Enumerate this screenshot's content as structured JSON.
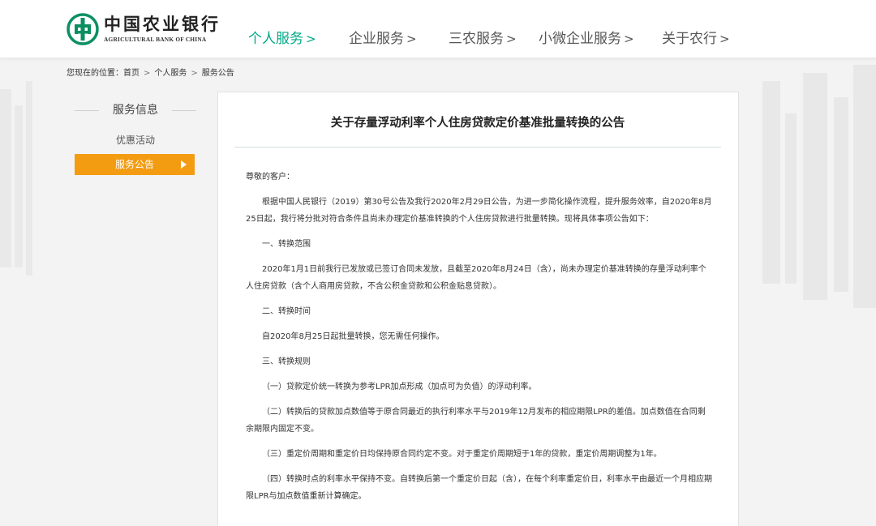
{
  "header": {
    "logo_cn": "中国农业银行",
    "logo_en": "AGRICULTURAL BANK OF CHINA",
    "nav": [
      {
        "label": "个人服务",
        "arrow": ">"
      },
      {
        "label": "企业服务",
        "arrow": ">"
      },
      {
        "label": "三农服务",
        "arrow": ">"
      },
      {
        "label": "小微企业服务",
        "arrow": ">"
      },
      {
        "label": "关于农行",
        "arrow": ">"
      }
    ]
  },
  "breadcrumb": {
    "prefix": "您现在的位置：",
    "items": [
      "首页",
      "个人服务",
      "服务公告"
    ],
    "sep": ">"
  },
  "sidebar": {
    "title": "服务信息",
    "items": [
      "优惠活动",
      "服务公告"
    ]
  },
  "article": {
    "title": "关于存量浮动利率个人住房贷款定价基准批量转换的公告",
    "paragraphs": [
      "尊敬的客户：",
      "根据中国人民银行（2019）第30号公告及我行2020年2月29日公告，为进一步简化操作流程，提升服务效率，自2020年8月25日起，我行将分批对符合条件且尚未办理定价基准转换的个人住房贷款进行批量转换。现将具体事项公告如下：",
      "一、转换范围",
      "2020年1月1日前我行已发放或已签订合同未发放，且截至2020年8月24日（含），尚未办理定价基准转换的存量浮动利率个人住房贷款（含个人商用房贷款，不含公积金贷款和公积金贴息贷款）。",
      "二、转换时间",
      "自2020年8月25日起批量转换，您无需任何操作。",
      "三、转换规则",
      "（一）贷款定价统一转换为参考LPR加点形成（加点可为负值）的浮动利率。",
      "（二）转换后的贷款加点数值等于原合同最近的执行利率水平与2019年12月发布的相应期限LPR的差值。加点数值在合同剩余期限内固定不变。",
      "（三）重定价周期和重定价日均保持原合同约定不变。对于重定价周期短于1年的贷款，重定价周期调整为1年。",
      "（四）转换时点的利率水平保持不变。自转换后第一个重定价日起（含），在每个利率重定价日，利率水平由最近一个月相应期限LPR与加点数值重新计算确定。"
    ]
  },
  "colors": {
    "brand_green": "#00a886",
    "accent_orange": "#f39c12",
    "logo_green": "#0b8f61"
  }
}
